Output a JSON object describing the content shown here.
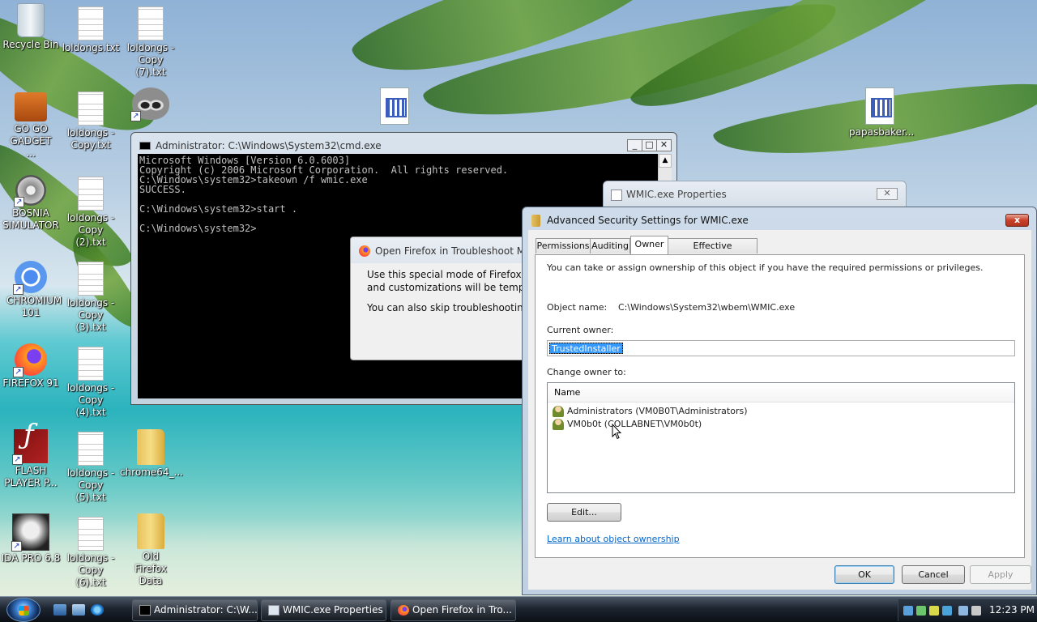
{
  "desktop": {
    "icons": [
      {
        "label": "Recycle Bin",
        "icon": "recycle-bin-icon"
      },
      {
        "label": "loldongs.txt",
        "icon": "text-file-icon"
      },
      {
        "label": "loldongs - Copy (7).txt",
        "icon": "text-file-icon"
      },
      {
        "label": "GO GO GADGET ...",
        "icon": "briefcase-icon"
      },
      {
        "label": "loldongs - Copy.txt",
        "icon": "text-file-icon"
      },
      {
        "label": "BOSNIA SIMULATOR",
        "icon": "gear-icon"
      },
      {
        "label": "loldongs - Copy (2).txt",
        "icon": "text-file-icon"
      },
      {
        "label": "CHROMIUM 101",
        "icon": "chromium-icon"
      },
      {
        "label": "loldongs - Copy (3).txt",
        "icon": "text-file-icon"
      },
      {
        "label": "FIREFOX 91",
        "icon": "firefox-icon"
      },
      {
        "label": "loldongs - Copy (4).txt",
        "icon": "text-file-icon"
      },
      {
        "label": "FLASH PLAYER P...",
        "icon": "flash-player-icon"
      },
      {
        "label": "loldongs - Copy (5).txt",
        "icon": "text-file-icon"
      },
      {
        "label": "chrome64_...",
        "icon": "folder-icon"
      },
      {
        "label": "IDA PRO 6.8",
        "icon": "ida-pro-icon"
      },
      {
        "label": "loldongs - Copy (6).txt",
        "icon": "text-file-icon"
      },
      {
        "label": "Old Firefox Data",
        "icon": "folder-icon"
      },
      {
        "label": "papasbaker...",
        "icon": "application-icon"
      }
    ]
  },
  "cmd": {
    "title": "Administrator: C:\\Windows\\System32\\cmd.exe",
    "lines": "Microsoft Windows [Version 6.0.6003]\nCopyright (c) 2006 Microsoft Corporation.  All rights reserved.\nC:\\Windows\\system32>takeown /f wmic.exe\nSUCCESS.\n\nC:\\Windows\\system32>start .\n\nC:\\Windows\\system32>",
    "minimize": "_",
    "maximize": "□",
    "close": "✕"
  },
  "firefox_dialog": {
    "title": "Open Firefox in Troubleshoot Mode",
    "line1": "Use this special mode of Firefox to d",
    "line2": "and customizations will be temporar",
    "line3": "You can also skip troubleshooting a"
  },
  "wmic_props": {
    "title": "WMIC.exe Properties",
    "close": "✕"
  },
  "adv": {
    "title": "Advanced Security Settings for WMIC.exe",
    "close": "x",
    "tabs": [
      "Permissions",
      "Auditing",
      "Owner",
      "Effective Permissions"
    ],
    "active_tab": "Owner",
    "intro": "You can take or assign ownership of this object if you have the required permissions or privileges.",
    "object_name_label": "Object name:",
    "object_name": "C:\\Windows\\System32\\wbem\\WMIC.exe",
    "current_owner_label": "Current owner:",
    "current_owner": "TrustedInstaller",
    "change_owner_label": "Change owner to:",
    "list_header": "Name",
    "owners": [
      "Administrators (VM0B0T\\Administrators)",
      "VM0b0t (COLLABNET\\VM0b0t)"
    ],
    "edit_button": "Edit...",
    "learn_link": "Learn about object ownership",
    "ok": "OK",
    "cancel": "Cancel",
    "apply": "Apply"
  },
  "taskbar": {
    "buttons": [
      "Administrator: C:\\W...",
      "WMIC.exe Properties",
      "Open Firefox in Tro..."
    ],
    "clock": "12:23 PM"
  }
}
